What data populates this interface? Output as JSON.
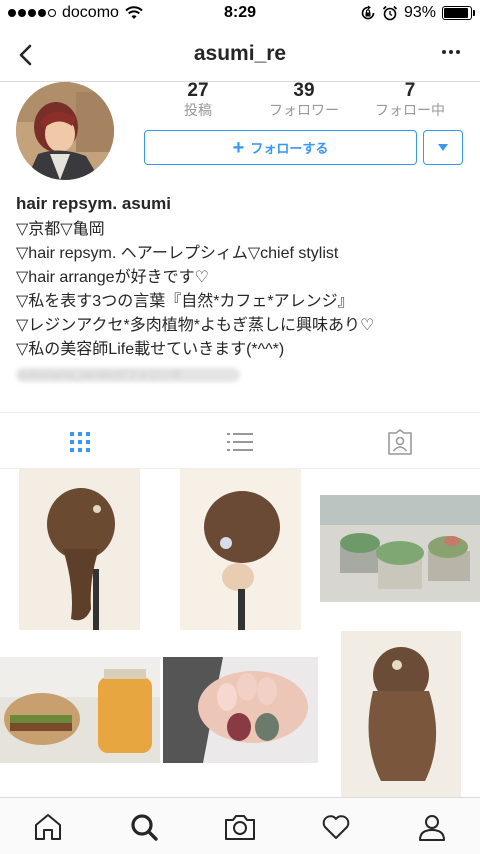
{
  "status_bar": {
    "carrier": "docomo",
    "time": "8:29",
    "battery": "93%",
    "battery_level": 0.93
  },
  "nav": {
    "title": "asumi_re"
  },
  "stats": [
    {
      "value": "27",
      "label": "投稿"
    },
    {
      "value": "39",
      "label": "フォロワー"
    },
    {
      "value": "7",
      "label": "フォロー中"
    }
  ],
  "follow_button": {
    "plus": "+",
    "label": "フォローする"
  },
  "bio": {
    "name": "hair repsym. asumi",
    "lines": [
      "▽京都▽亀岡",
      "▽hair repsym. ヘアーレプシィム▽chief stylist",
      "▽hair arrangeが好きです♡",
      "▽私を表す3つの言葉『自然*カフェ*アレンジ』",
      "▽レジンアクセ*多肉植物*よもぎ蒸しに興味あり♡",
      "▽私の美容師Life載せていきます(*^^*)"
    ],
    "blurred_text": "kokomama_sanakoがフォロー中"
  },
  "colors": {
    "accent": "#3897f0",
    "text": "#262626",
    "muted": "#999999",
    "divider": "#dbdbdb"
  },
  "tabs": [
    {
      "icon": "grid-icon",
      "active": true
    },
    {
      "icon": "list-icon",
      "active": false
    },
    {
      "icon": "tagged-photos-icon",
      "active": false
    }
  ],
  "bottom_nav": [
    {
      "icon": "home-icon"
    },
    {
      "icon": "search-icon",
      "active": true
    },
    {
      "icon": "camera-icon"
    },
    {
      "icon": "heart-icon"
    },
    {
      "icon": "profile-icon"
    }
  ]
}
